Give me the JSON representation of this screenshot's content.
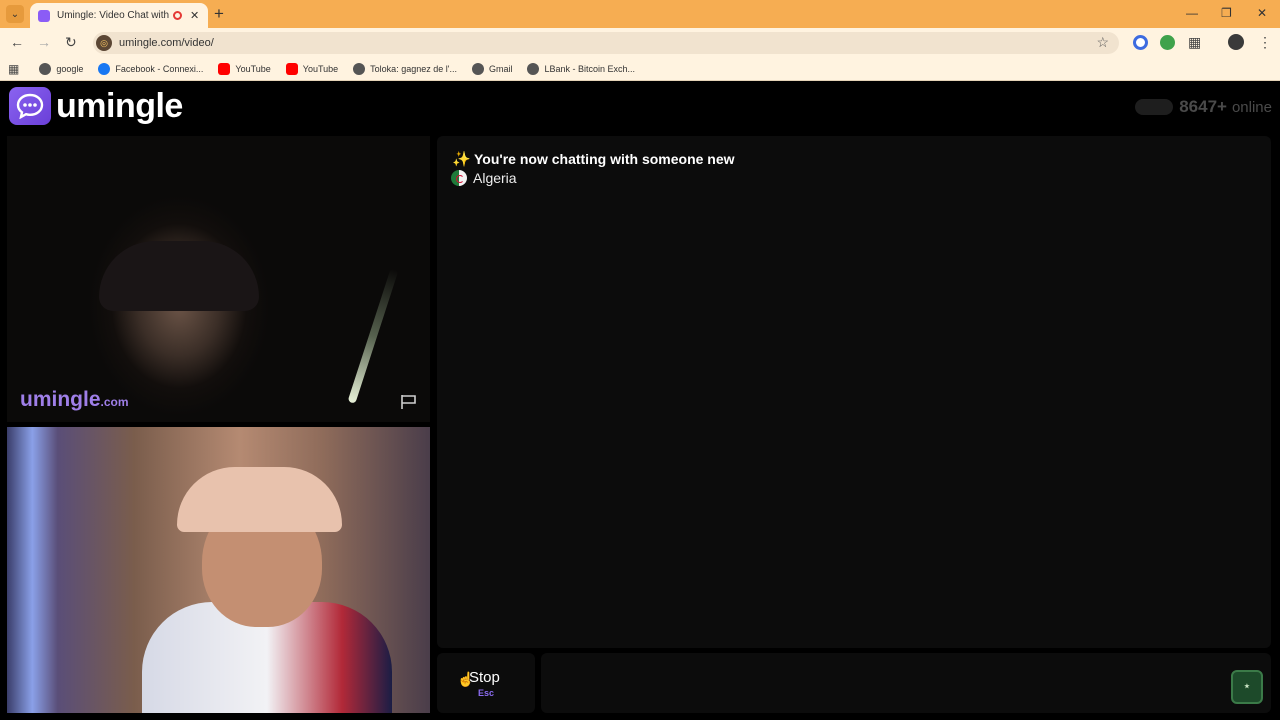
{
  "browser": {
    "tab_title": "Umingle: Video Chat with St",
    "url": "umingle.com/video/",
    "bookmarks": [
      {
        "label": "google",
        "icon": "globe-icon",
        "color": "#555555"
      },
      {
        "label": "Facebook - Connexi...",
        "icon": "facebook-icon",
        "color": "#1877f2"
      },
      {
        "label": "YouTube",
        "icon": "youtube-icon",
        "color": "#ff0000"
      },
      {
        "label": "YouTube",
        "icon": "youtube-icon",
        "color": "#ff0000"
      },
      {
        "label": "Toloka: gagnez de l'...",
        "icon": "globe-icon",
        "color": "#555555"
      },
      {
        "label": "Gmail",
        "icon": "globe-icon",
        "color": "#555555"
      },
      {
        "label": "LBank - Bitcoin Exch...",
        "icon": "globe-icon",
        "color": "#555555"
      }
    ]
  },
  "app": {
    "logo_text": "umingle",
    "online_count": "8647+",
    "online_label": "online",
    "watermark_main": "umingle",
    "watermark_suffix": ".com",
    "chat": {
      "status_icon": "sparkles-icon",
      "status_message": "You're now chatting with someone new",
      "country": "Algeria"
    },
    "stop_label": "Stop",
    "stop_shortcut": "Esc",
    "message_input_value": ""
  },
  "colors": {
    "accent": "#8b6cf0",
    "tabbar": "#f6ad52",
    "panel": "#0c0c0c"
  }
}
